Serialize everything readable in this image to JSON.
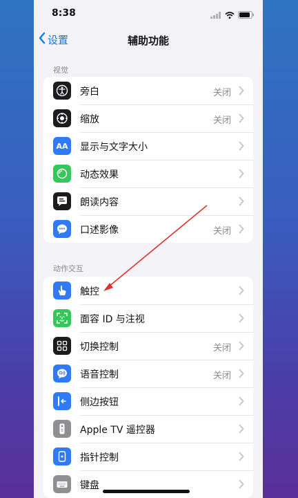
{
  "status": {
    "time": "8:38"
  },
  "nav": {
    "back_label": "设置",
    "title": "辅助功能"
  },
  "sections": [
    {
      "header": "视觉",
      "items": [
        {
          "label": "旁白",
          "value": "关闭",
          "icon": "voiceover-icon",
          "color": "#1c1c1e"
        },
        {
          "label": "缩放",
          "value": "关闭",
          "icon": "zoom-icon",
          "color": "#1c1c1e"
        },
        {
          "label": "显示与文字大小",
          "value": "",
          "icon": "display-text-size-icon",
          "color": "#2f7bf5",
          "icon_text": "AA"
        },
        {
          "label": "动态效果",
          "value": "",
          "icon": "motion-icon",
          "color": "#34c759"
        },
        {
          "label": "朗读内容",
          "value": "",
          "icon": "spoken-content-icon",
          "color": "#1c1c1e"
        },
        {
          "label": "口述影像",
          "value": "关闭",
          "icon": "audio-description-icon",
          "color": "#2f7bf5"
        }
      ]
    },
    {
      "header": "动作交互",
      "items": [
        {
          "label": "触控",
          "value": "",
          "icon": "touch-icon",
          "color": "#2f7bf5"
        },
        {
          "label": "面容 ID 与注视",
          "value": "",
          "icon": "face-id-icon",
          "color": "#34c759"
        },
        {
          "label": "切换控制",
          "value": "关闭",
          "icon": "switch-control-icon",
          "color": "#1c1c1e"
        },
        {
          "label": "语音控制",
          "value": "关闭",
          "icon": "voice-control-icon",
          "color": "#2f7bf5"
        },
        {
          "label": "侧边按钮",
          "value": "",
          "icon": "side-button-icon",
          "color": "#2f7bf5"
        },
        {
          "label": "Apple TV 遥控器",
          "value": "",
          "icon": "apple-tv-remote-icon",
          "color": "#8e8e93"
        },
        {
          "label": "指针控制",
          "value": "",
          "icon": "pointer-control-icon",
          "color": "#2f7bf5"
        },
        {
          "label": "键盘",
          "value": "",
          "icon": "keyboard-icon",
          "color": "#8e8e93"
        }
      ]
    }
  ]
}
